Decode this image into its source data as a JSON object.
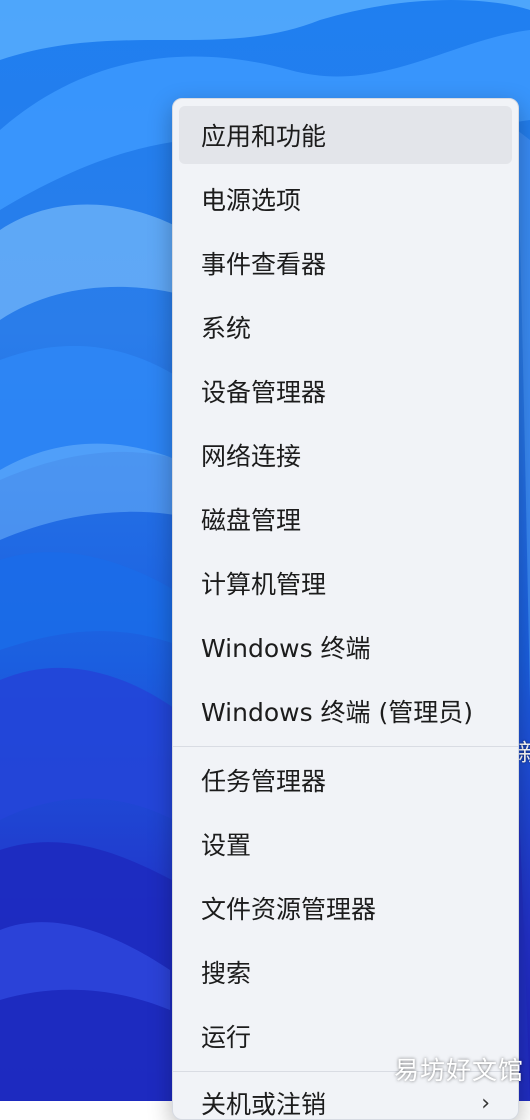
{
  "menu": {
    "items": [
      {
        "label": "应用和功能"
      },
      {
        "label": "电源选项"
      },
      {
        "label": "事件查看器"
      },
      {
        "label": "系统"
      },
      {
        "label": "设备管理器"
      },
      {
        "label": "网络连接"
      },
      {
        "label": "磁盘管理"
      },
      {
        "label": "计算机管理"
      },
      {
        "label": "Windows 终端"
      },
      {
        "label": "Windows 终端 (管理员)"
      },
      {
        "label": "任务管理器"
      },
      {
        "label": "设置"
      },
      {
        "label": "文件资源管理器"
      },
      {
        "label": "搜索"
      },
      {
        "label": "运行"
      },
      {
        "label": "关机或注销"
      }
    ],
    "submenu_arrow": "›"
  },
  "desktop": {
    "partial_text": "新"
  },
  "watermark": "易坊好文馆"
}
